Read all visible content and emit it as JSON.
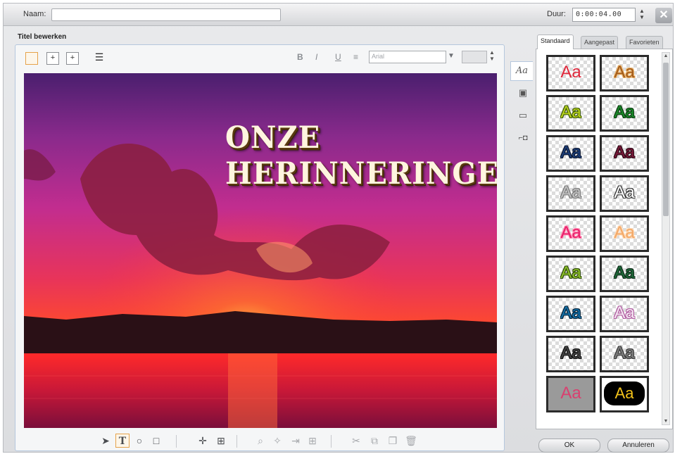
{
  "header": {
    "name_label": "Naam:",
    "name_value": "",
    "duration_label": "Duur:",
    "duration_value": "0:00:04.00",
    "close_symbol": "✕"
  },
  "editor": {
    "section_title": "Titel bewerken",
    "font_name": "Arial",
    "font_size": "",
    "title_text": "ONZE HERINNERINGEN",
    "format_buttons": [
      "B",
      "I",
      "U"
    ]
  },
  "style_panel": {
    "tabs": [
      "Standaard",
      "Aangepast",
      "Favorieten"
    ],
    "active_tab": "Standaard",
    "swatch_label": "Aa",
    "swatches": [
      {
        "color": "#e0283c",
        "outline": "none"
      },
      {
        "color": "#a25a1a",
        "outline": "#e9b26a"
      },
      {
        "color": "#b8d21e",
        "outline": "#3d5a08"
      },
      {
        "color": "#1a8a2a",
        "outline": "#0a3a0e"
      },
      {
        "color": "#1d3f7a",
        "outline": "#0b1630"
      },
      {
        "color": "#7a1a3a",
        "outline": "#2a0714"
      },
      {
        "color": "#c0c0c0",
        "outline": "#7a7a7a"
      },
      {
        "color": "#ffffff",
        "outline": "#333333"
      },
      {
        "color": "#e8206a",
        "outline": "#ff8fb5"
      },
      {
        "color": "#f2a868",
        "outline": "#ffd9b4"
      },
      {
        "color": "#8cbf2a",
        "outline": "#2e4a0a"
      },
      {
        "color": "#1f6a3a",
        "outline": "#0d2a18"
      },
      {
        "color": "#1470a8",
        "outline": "#06243a"
      },
      {
        "color": "#f4e6f2",
        "outline": "#b05aa0"
      },
      {
        "color": "#444444",
        "outline": "#111111"
      },
      {
        "color": "#7d7d7d",
        "outline": "#3a3a3a"
      },
      {
        "color": "#d94070",
        "outline": "none"
      },
      {
        "color": "#f2c21a",
        "outline": "#000000"
      }
    ]
  },
  "buttons": {
    "ok": "OK",
    "cancel": "Annuleren"
  }
}
